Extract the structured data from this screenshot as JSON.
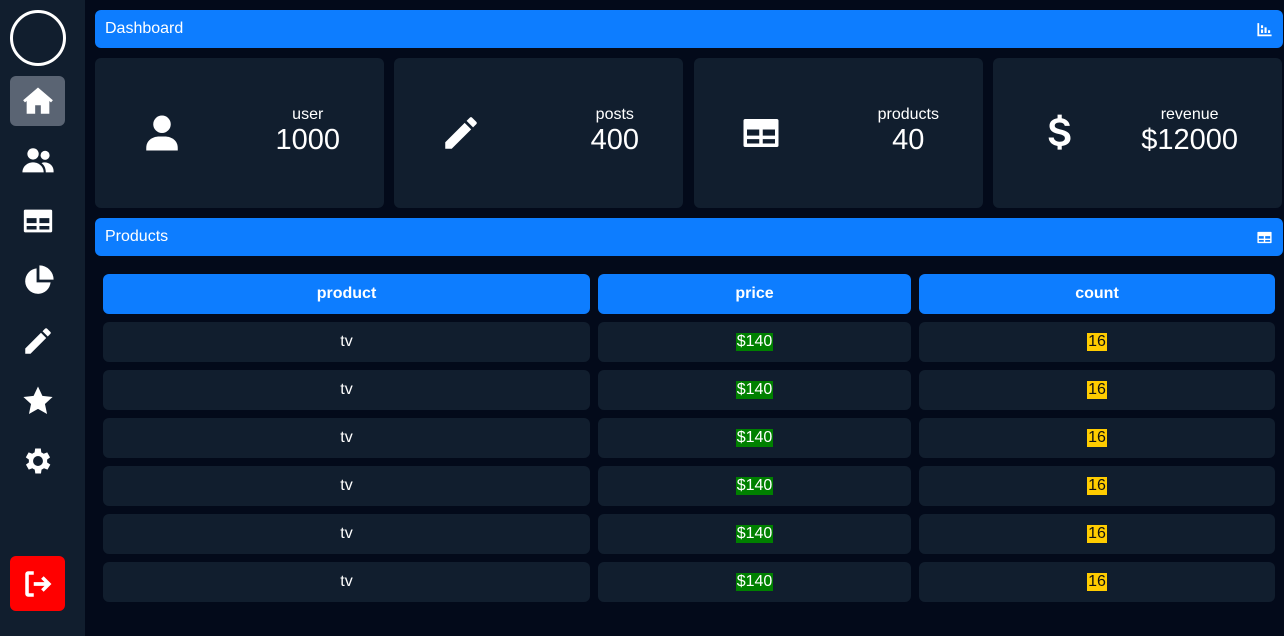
{
  "sidebar": {
    "items": [
      {
        "icon": "home-icon",
        "active": true
      },
      {
        "icon": "users-icon",
        "active": false
      },
      {
        "icon": "table-icon",
        "active": false
      },
      {
        "icon": "pie-chart-icon",
        "active": false
      },
      {
        "icon": "pencil-icon",
        "active": false
      },
      {
        "icon": "star-icon",
        "active": false
      },
      {
        "icon": "gear-icon",
        "active": false
      }
    ],
    "logout_icon": "logout-icon"
  },
  "dashboard": {
    "title": "Dashboard",
    "icon": "bar-chart-icon",
    "cards": [
      {
        "icon": "user-icon",
        "label": "user",
        "value": "1000"
      },
      {
        "icon": "pencil-icon",
        "label": "posts",
        "value": "400"
      },
      {
        "icon": "table-icon",
        "label": "products",
        "value": "40"
      },
      {
        "icon": "dollar-icon",
        "label": "revenue",
        "value": "$12000"
      }
    ]
  },
  "products": {
    "title": "Products",
    "icon": "table-icon",
    "columns": [
      "product",
      "price",
      "count"
    ],
    "rows": [
      {
        "product": "tv",
        "price": "$140",
        "count": "16"
      },
      {
        "product": "tv",
        "price": "$140",
        "count": "16"
      },
      {
        "product": "tv",
        "price": "$140",
        "count": "16"
      },
      {
        "product": "tv",
        "price": "$140",
        "count": "16"
      },
      {
        "product": "tv",
        "price": "$140",
        "count": "16"
      },
      {
        "product": "tv",
        "price": "$140",
        "count": "16"
      }
    ]
  },
  "colors": {
    "accent": "#0d7dff",
    "panel": "#111e2e",
    "background": "#030a1a",
    "logout": "#ff0000",
    "price_highlight": "#008000",
    "count_highlight": "#ffcc00"
  }
}
